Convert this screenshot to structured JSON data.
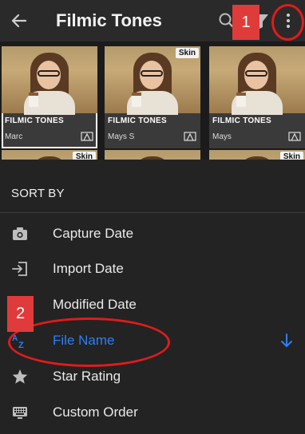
{
  "header": {
    "title": "Filmic Tones",
    "back_icon": "arrow-left-icon",
    "search_icon": "search-icon",
    "filter_icon": "filter-icon",
    "more_icon": "more-vertical-icon"
  },
  "annotations": {
    "marker_1": "1",
    "marker_2": "2",
    "color": "#e01b1b"
  },
  "grid": {
    "items": [
      {
        "label": "FILMIC TONES",
        "author": "Marc",
        "badge": ""
      },
      {
        "label": "FILMIC TONES",
        "author": "Mays S",
        "badge": "Skin"
      },
      {
        "label": "FILMIC TONES",
        "author": "Mays",
        "badge": ""
      },
      {
        "label": "",
        "author": "",
        "badge": "Skin"
      },
      {
        "label": "",
        "author": "",
        "badge": ""
      },
      {
        "label": "",
        "author": "",
        "badge": "Skin"
      }
    ]
  },
  "sort_sheet": {
    "title": "SORT BY",
    "accent": "#2d7ef7",
    "options": [
      {
        "label": "Capture Date",
        "icon": "camera-icon",
        "active": false
      },
      {
        "label": "Import Date",
        "icon": "import-icon",
        "active": false
      },
      {
        "label": "Modified Date",
        "icon": "pencil-icon",
        "active": false
      },
      {
        "label": "File Name",
        "icon": "sort-az-icon",
        "active": true,
        "direction": "descending"
      },
      {
        "label": "Star Rating",
        "icon": "star-icon",
        "active": false
      },
      {
        "label": "Custom Order",
        "icon": "keyboard-icon",
        "active": false
      }
    ]
  }
}
